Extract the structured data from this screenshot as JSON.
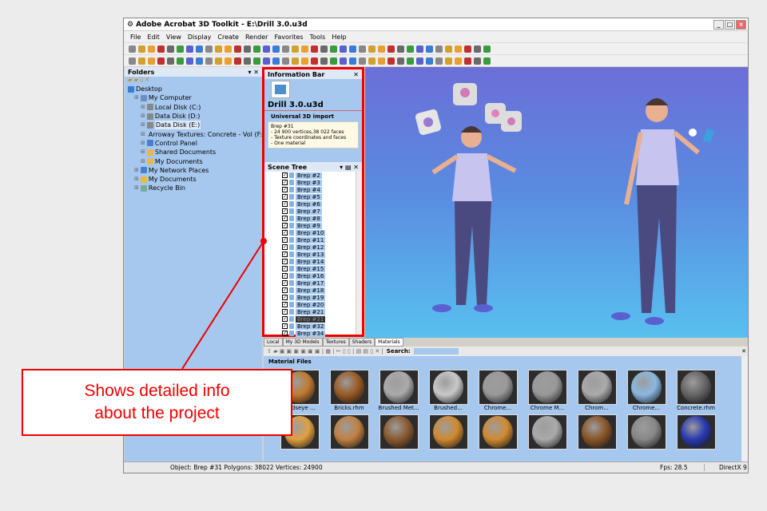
{
  "window": {
    "title": "Adobe Acrobat 3D Toolkit - E:\\Drill 3.0.u3d"
  },
  "menu": [
    "File",
    "Edit",
    "View",
    "Display",
    "Create",
    "Render",
    "Favorites",
    "Tools",
    "Help"
  ],
  "folders": {
    "title": "Folders",
    "items": [
      {
        "label": "Desktop",
        "indent": 0,
        "color": "#3a7bd5"
      },
      {
        "label": "My Computer",
        "indent": 1,
        "color": "#6a8fc0"
      },
      {
        "label": "Local Disk (C:)",
        "indent": 2,
        "color": "#888"
      },
      {
        "label": "Data Disk (D:)",
        "indent": 2,
        "color": "#888"
      },
      {
        "label": "Data Disk (E:)",
        "indent": 2,
        "color": "#888",
        "selected": true
      },
      {
        "label": "Arroway Textures: Concrete - Vol (F:)",
        "indent": 2,
        "color": "#777"
      },
      {
        "label": "Control Panel",
        "indent": 2,
        "color": "#4a7fd0"
      },
      {
        "label": "Shared Documents",
        "indent": 2,
        "color": "#e8b84a"
      },
      {
        "label": "My Documents",
        "indent": 2,
        "color": "#e8b84a"
      },
      {
        "label": "My Network Places",
        "indent": 1,
        "color": "#4a7fd0"
      },
      {
        "label": "My Documents",
        "indent": 1,
        "color": "#e8b84a"
      },
      {
        "label": "Recycle Bin",
        "indent": 1,
        "color": "#7a9"
      }
    ]
  },
  "info_bar": {
    "title": "Information Bar",
    "file": "Drill 3.0.u3d",
    "section": "Universal 3D import",
    "details": [
      "Brep #31",
      "- 24 900 vertices,38 022 faces",
      "- Texture coordinates and faces",
      "- One material"
    ]
  },
  "scene_tree": {
    "title": "Scene Tree",
    "items": [
      "Brep #2",
      "Brep #3",
      "Brep #4",
      "Brep #5",
      "Brep #6",
      "Brep #7",
      "Brep #8",
      "Brep #9",
      "Brep #10",
      "Brep #11",
      "Brep #12",
      "Brep #13",
      "Brep #14",
      "Brep #15",
      "Brep #16",
      "Brep #17",
      "Brep #18",
      "Brep #19",
      "Brep #20",
      "Brep #21",
      "Brep #31",
      "Brep #32",
      "Brep #34"
    ],
    "selected": "Brep #31"
  },
  "tabs": [
    "Local",
    "My 3D Models",
    "Textures",
    "Shaders",
    "Materials"
  ],
  "active_tab": "Materials",
  "materials": {
    "search_label": "Search:",
    "search_value": "",
    "title": "Material Files",
    "items": [
      {
        "label": "Birdseye ...",
        "color": "#c07a30"
      },
      {
        "label": "Bricks.rhm",
        "color": "#9a5a25"
      },
      {
        "label": "Brushed Met...",
        "color": "#aaa"
      },
      {
        "label": "Brushed...",
        "color": "#c8c8c8"
      },
      {
        "label": "Chrome...",
        "color": "#999"
      },
      {
        "label": "Chrome M...",
        "color": "#999"
      },
      {
        "label": "Chrom...",
        "color": "#aaa"
      },
      {
        "label": "Chrome...",
        "color": "#8ab8e0"
      },
      {
        "label": "Concrete.rhm",
        "color": "#666"
      },
      {
        "label": "",
        "color": "#e0a040"
      },
      {
        "label": "",
        "color": "#c08040"
      },
      {
        "label": "",
        "color": "#8a5a30"
      },
      {
        "label": "",
        "color": "#d08a30"
      },
      {
        "label": "",
        "color": "#d08a30"
      },
      {
        "label": "",
        "color": "#aaa"
      },
      {
        "label": "",
        "color": "#8a5528"
      },
      {
        "label": "",
        "color": "#888"
      },
      {
        "label": "",
        "color": "#2a3ab0"
      }
    ]
  },
  "status": {
    "object": "Object: Brep #31 Polygons: 38022 Vertices: 24900",
    "fps": "Fps: 28.5",
    "renderer": "DirectX 9"
  },
  "callout": {
    "line1": "Shows detailed info",
    "line2": "about the project"
  }
}
